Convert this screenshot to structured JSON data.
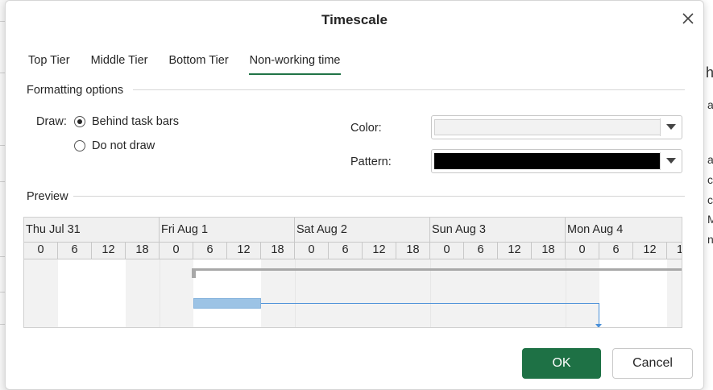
{
  "dialog": {
    "title": "Timescale",
    "tabs": [
      {
        "label": "Top Tier",
        "active": false
      },
      {
        "label": "Middle Tier",
        "active": false
      },
      {
        "label": "Bottom Tier",
        "active": false
      },
      {
        "label": "Non-working time",
        "active": true
      }
    ],
    "formatting": {
      "section_label": "Formatting options",
      "draw_label": "Draw:",
      "options": [
        {
          "label": "Behind task bars",
          "checked": true
        },
        {
          "label": "Do not draw",
          "checked": false
        }
      ],
      "color_label": "Color:",
      "color_value": "#f2f2f2",
      "pattern_label": "Pattern:",
      "pattern_value": "#000000"
    },
    "preview": {
      "section_label": "Preview",
      "days": [
        "Thu Jul 31",
        "Fri Aug 1",
        "Sat Aug 2",
        "Sun Aug 3",
        "Mon Aug 4"
      ],
      "hours": [
        "0",
        "6",
        "12",
        "18"
      ],
      "trailing_hour": "1"
    },
    "buttons": {
      "ok": "OK",
      "cancel": "Cancel"
    },
    "colors": {
      "accent": "#217346",
      "ok_bg": "#1e7145",
      "task_bar": "#9cc3e5",
      "link": "#4a90d9",
      "nonworking": "#f2f2f2"
    }
  },
  "background": {
    "fragments": [
      "h",
      "ab",
      "a",
      "c",
      "c",
      "M",
      "n"
    ]
  }
}
